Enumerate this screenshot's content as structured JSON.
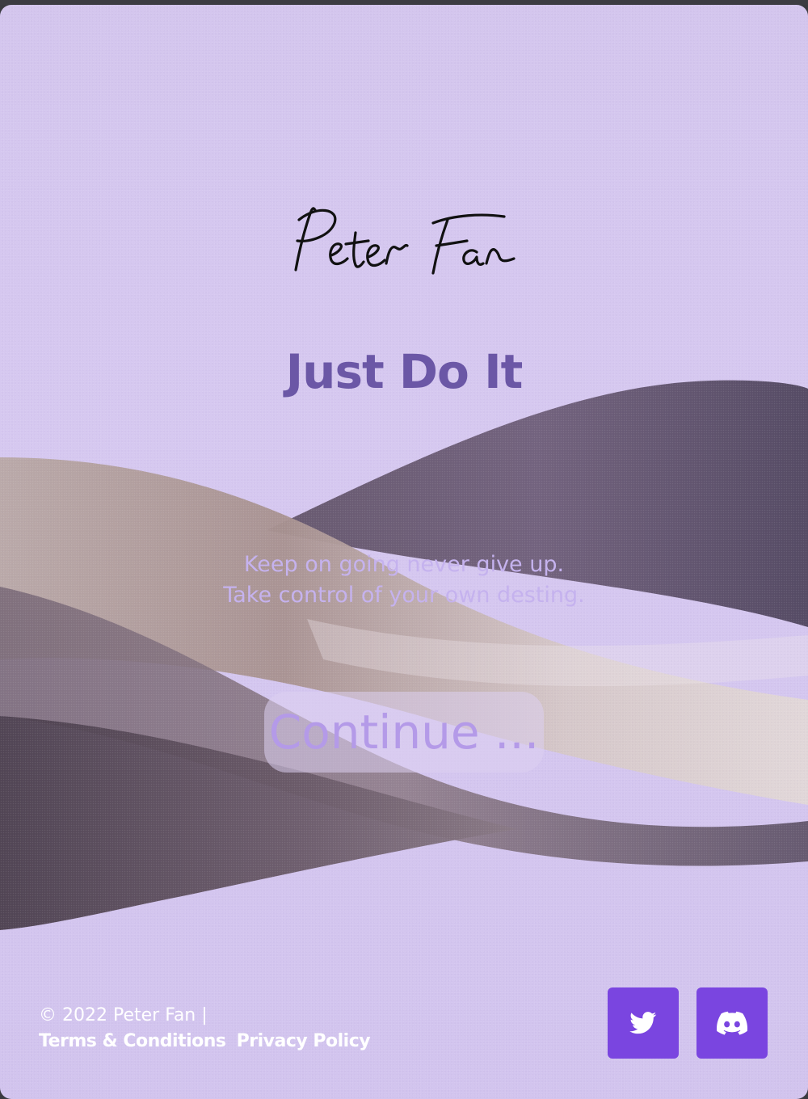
{
  "brand": {
    "logo_text": "Peter Fan"
  },
  "hero": {
    "headline": "Just Do It",
    "tagline_line1": "Keep on going never give up.",
    "tagline_line2": "Take control of your own desting.",
    "continue_label": "Continue ..."
  },
  "footer": {
    "copyright": "© 2022 Peter Fan  |",
    "links": [
      {
        "label": "Terms & Conditions"
      },
      {
        "label": "Privacy Policy"
      }
    ],
    "social": [
      {
        "icon": "twitter-icon"
      },
      {
        "icon": "discord-icon"
      }
    ]
  },
  "colors": {
    "background": "#d4c6ee",
    "headline": "#6b57a6",
    "tagline": "#c5b2ee",
    "social_button": "#7a45e0",
    "footer_text": "#ffffff"
  }
}
